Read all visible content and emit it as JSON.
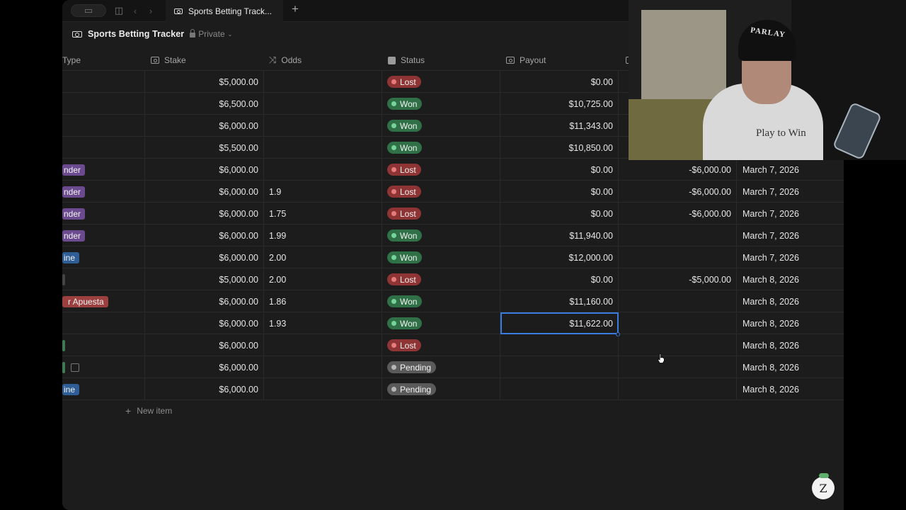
{
  "browser": {
    "tab_title": "Sports Betting Track...",
    "new_tab_symbol": "+"
  },
  "page": {
    "title": "Sports Betting Tracker",
    "privacy": "Private"
  },
  "columns": {
    "type": "Type",
    "stake": "Stake",
    "odds": "Odds",
    "status": "Status",
    "payout": "Payout"
  },
  "rows": [
    {
      "type": "",
      "type_color": "",
      "stake": "$5,000.00",
      "odds": "",
      "status": "Lost",
      "status_kind": "lost",
      "payout": "$0.00",
      "profit": "",
      "date": ""
    },
    {
      "type": "",
      "type_color": "",
      "stake": "$6,500.00",
      "odds": "",
      "status": "Won",
      "status_kind": "won",
      "payout": "$10,725.00",
      "profit": "",
      "date": ""
    },
    {
      "type": "",
      "type_color": "",
      "stake": "$6,000.00",
      "odds": "",
      "status": "Won",
      "status_kind": "won",
      "payout": "$11,343.00",
      "profit": "",
      "date": ""
    },
    {
      "type": "",
      "type_color": "",
      "stake": "$5,500.00",
      "odds": "",
      "status": "Won",
      "status_kind": "won",
      "payout": "$10,850.00",
      "profit": "",
      "date": ""
    },
    {
      "type": "nder",
      "type_color": "purple",
      "stake": "$6,000.00",
      "odds": "",
      "status": "Lost",
      "status_kind": "lost",
      "payout": "$0.00",
      "profit": "-$6,000.00",
      "date": "March 7, 2026"
    },
    {
      "type": "nder",
      "type_color": "purple",
      "stake": "$6,000.00",
      "odds": "1.9",
      "status": "Lost",
      "status_kind": "lost",
      "payout": "$0.00",
      "profit": "-$6,000.00",
      "date": "March 7, 2026"
    },
    {
      "type": "nder",
      "type_color": "purple",
      "stake": "$6,000.00",
      "odds": "1.75",
      "status": "Lost",
      "status_kind": "lost",
      "payout": "$0.00",
      "profit": "-$6,000.00",
      "date": "March 7, 2026"
    },
    {
      "type": "nder",
      "type_color": "purple",
      "stake": "$6,000.00",
      "odds": "1.99",
      "status": "Won",
      "status_kind": "won",
      "payout": "$11,940.00",
      "profit": "",
      "date": "March 7, 2026"
    },
    {
      "type": "ine",
      "type_color": "blue",
      "stake": "$6,000.00",
      "odds": "2.00",
      "status": "Won",
      "status_kind": "won",
      "payout": "$12,000.00",
      "profit": "",
      "date": "March 7, 2026"
    },
    {
      "type": "",
      "type_color": "gray",
      "stake": "$5,000.00",
      "odds": "2.00",
      "status": "Lost",
      "status_kind": "lost",
      "payout": "$0.00",
      "profit": "-$5,000.00",
      "date": "March 8, 2026"
    },
    {
      "type": "r Apuesta",
      "type_color": "red",
      "stake": "$6,000.00",
      "odds": "1.86",
      "status": "Won",
      "status_kind": "won",
      "payout": "$11,160.00",
      "profit": "",
      "date": "March 8, 2026"
    },
    {
      "type": "",
      "type_color": "",
      "stake": "$6,000.00",
      "odds": "1.93",
      "status": "Won",
      "status_kind": "won",
      "payout": "$11,622.00",
      "profit": "",
      "date": "March 8, 2026",
      "selected": "payout"
    },
    {
      "type": "",
      "type_color": "green",
      "stake": "$6,000.00",
      "odds": "",
      "status": "Lost",
      "status_kind": "lost",
      "payout": "",
      "profit": "",
      "date": "March 8, 2026"
    },
    {
      "type": "",
      "type_color": "green",
      "checkbox": true,
      "stake": "$6,000.00",
      "odds": "",
      "status": "Pending",
      "status_kind": "pending",
      "payout": "",
      "profit": "",
      "date": "March 8, 2026"
    },
    {
      "type": "ine",
      "type_color": "blue",
      "stake": "$6,000.00",
      "odds": "",
      "status": "Pending",
      "status_kind": "pending",
      "payout": "",
      "profit": "",
      "date": "March 8, 2026"
    }
  ],
  "new_item_label": "New item",
  "webcam": {
    "beanie_text": "PARLAY",
    "shirt_text": "Play to Win"
  },
  "badge_letter": "Z",
  "colors": {
    "won": "#2f7047",
    "lost": "#8f3434",
    "pending": "#5a5a5a",
    "selection": "#3a7be0"
  }
}
